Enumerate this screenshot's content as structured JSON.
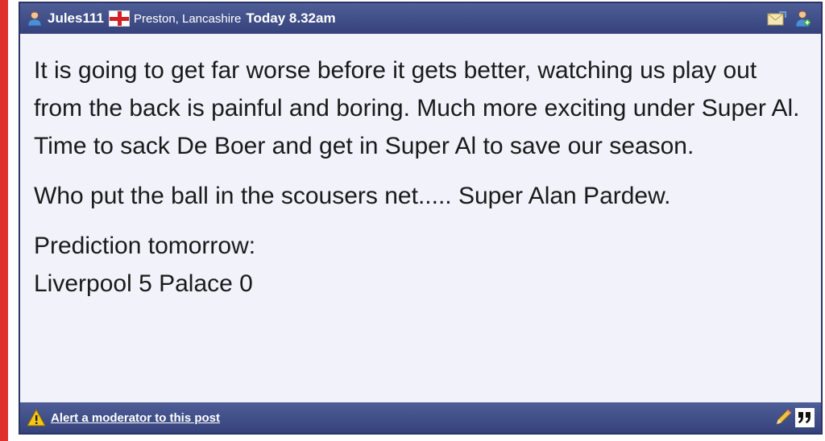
{
  "post": {
    "username": "Jules111",
    "location": "Preston, Lancashire",
    "timestamp": "Today 8.32am",
    "body": {
      "paragraph1": "It is going to get far worse before it gets better, watching us play out from the back is painful and boring. Much more exciting under Super Al. Time to sack De Boer and get in Super Al to save our season.",
      "paragraph2": "Who put the ball in the scousers net..... Super Alan Pardew.",
      "paragraph3_line1": "Prediction tomorrow:",
      "paragraph3_line2": "Liverpool 5 Palace 0"
    },
    "footer": {
      "alert_link": "Alert a moderator to this post"
    },
    "icons": {
      "user": "user-icon",
      "flag": "england-flag-icon",
      "message": "envelope-icon",
      "add_friend": "add-user-icon",
      "warning": "warning-icon",
      "edit": "pencil-icon",
      "quote": "quote-icon"
    },
    "colors": {
      "header_bg": "#3f4c86",
      "body_bg": "#f1f2fa",
      "accent_red": "#e0302d"
    }
  }
}
